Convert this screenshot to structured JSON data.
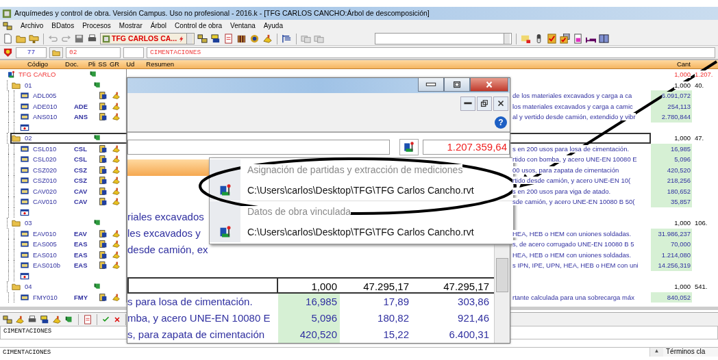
{
  "window": {
    "title": "Arquímedes y control de obra. Versión Campus. Uso no profesional - 2016.k - [TFG CARLOS CANCHO:Árbol de descomposición]"
  },
  "menu": [
    "Archivo",
    "BDatos",
    "Procesos",
    "Mostrar",
    "Árbol",
    "Control de obra",
    "Ventana",
    "Ayuda"
  ],
  "toolbar": {
    "project": "TFG CARLOS CA..."
  },
  "path_bar": {
    "count": "77",
    "chapter": "02",
    "summary": "CIMENTACIONES"
  },
  "columns": [
    "Código",
    "Doc.",
    "Pli",
    "SS",
    "GR",
    "Ud",
    "Resumen",
    "Cant"
  ],
  "tree": {
    "code": "TFG CARLO",
    "cant": "1,000",
    "amount": "1.207.",
    "children": [
      {
        "code": "01",
        "cant": "1,000",
        "amount": "40.",
        "selected": false,
        "children": [
          {
            "kind": "unit",
            "code": "ADL005",
            "summary": "de los materiales excavados y carga a ca",
            "cant": "6.091,072"
          },
          {
            "kind": "unit",
            "code": "ADE010",
            "doc": "ADE",
            "summary": "los materiales excavados y carga a camic",
            "cant": "254,113"
          },
          {
            "kind": "unit",
            "code": "ANS010",
            "doc": "ANS",
            "summary": "al y vertido desde camión, extendido y vibr",
            "cant": "2.780,844"
          },
          {
            "kind": "new"
          }
        ]
      },
      {
        "code": "02",
        "cant": "1,000",
        "amount": "47.",
        "selected": true,
        "children": [
          {
            "kind": "unit",
            "code": "CSL010",
            "doc": "CSL",
            "summary": "s en 200 usos para losa de cimentación.",
            "cant": "16,985"
          },
          {
            "kind": "unit",
            "code": "CSL020",
            "doc": "CSL",
            "summary": "rtido con bomba, y acero UNE-EN 10080 E",
            "cant": "5,096"
          },
          {
            "kind": "unit",
            "code": "CSZ020",
            "doc": "CSZ",
            "summary": "00 usos, para zapata de cimentación",
            "cant": "420,520"
          },
          {
            "kind": "unit",
            "code": "CSZ010",
            "doc": "CSZ",
            "summary": "rtido desde camión, y acero UNE-EN 10(",
            "cant": "218,256"
          },
          {
            "kind": "unit",
            "code": "CAV020",
            "doc": "CAV",
            "summary": "s en 200 usos para viga de atado.",
            "cant": "180,652"
          },
          {
            "kind": "unit",
            "code": "CAV010",
            "doc": "CAV",
            "summary": "sde camión, y acero UNE-EN 10080 B 50(",
            "cant": "35,857"
          },
          {
            "kind": "new"
          }
        ]
      },
      {
        "code": "03",
        "cant": "1,000",
        "amount": "106.",
        "selected": false,
        "children": [
          {
            "kind": "unit",
            "code": "EAV010",
            "doc": "EAV",
            "summary": "HEA, HEB o HEM con uniones soldadas.",
            "cant": "31.986,237"
          },
          {
            "kind": "unit",
            "code": "EAS005",
            "doc": "EAS",
            "summary": "s, de acero corrugado UNE-EN 10080 B 5",
            "cant": "70,000"
          },
          {
            "kind": "unit",
            "code": "EAS010",
            "doc": "EAS",
            "summary": "HEA, HEB o HEM con uniones soldadas.",
            "cant": "1.214,080"
          },
          {
            "kind": "unit",
            "code": "EAS010b",
            "doc": "EAS",
            "summary": "s IPN, IPE, UPN, HEA, HEB o HEM con uni",
            "cant": "14.256,319"
          },
          {
            "kind": "new"
          }
        ]
      },
      {
        "code": "04",
        "cant": "1,000",
        "amount": "541.",
        "selected": false,
        "children": [
          {
            "kind": "unit",
            "code": "FMY010",
            "doc": "FMY",
            "summary": "rtante calculada para una sobrecarga máx",
            "cant": "840,052"
          }
        ]
      }
    ]
  },
  "subwindow": {
    "help": "?",
    "total": "1.207.359,64",
    "lines": [
      "riales excavados",
      "les excavados y",
      "desde camión, ex"
    ],
    "chapter_row": {
      "cant": "1,000",
      "price": "47.295,17",
      "amount": "47.295,17"
    },
    "rows": [
      {
        "summary": "s para losa de cimentación.",
        "cant": "16,985",
        "price": "17,89",
        "amount": "303,86"
      },
      {
        "summary": "mba, y acero UNE-EN 10080 E",
        "cant": "5,096",
        "price": "180,82",
        "amount": "921,46"
      },
      {
        "summary": "s, para zapata de cimentación",
        "cant": "420,520",
        "price": "15,22",
        "amount": "6.400,31"
      }
    ]
  },
  "popup": [
    {
      "header": "Asignación de partidas y extracción de mediciones",
      "items": [
        "C:\\Users\\carlos\\Desktop\\TFG\\TFG Carlos Cancho.rvt"
      ]
    },
    {
      "header": "Datos de obra vinculada",
      "items": [
        "C:\\Users\\carlos\\Desktop\\TFG\\TFG Carlos Cancho.rvt"
      ]
    }
  ],
  "bottom": {
    "field": "CIMENTACIONES",
    "notes": "CIMENTACIONES",
    "scroll_glyph": "▲",
    "tab": "Términos cla"
  }
}
